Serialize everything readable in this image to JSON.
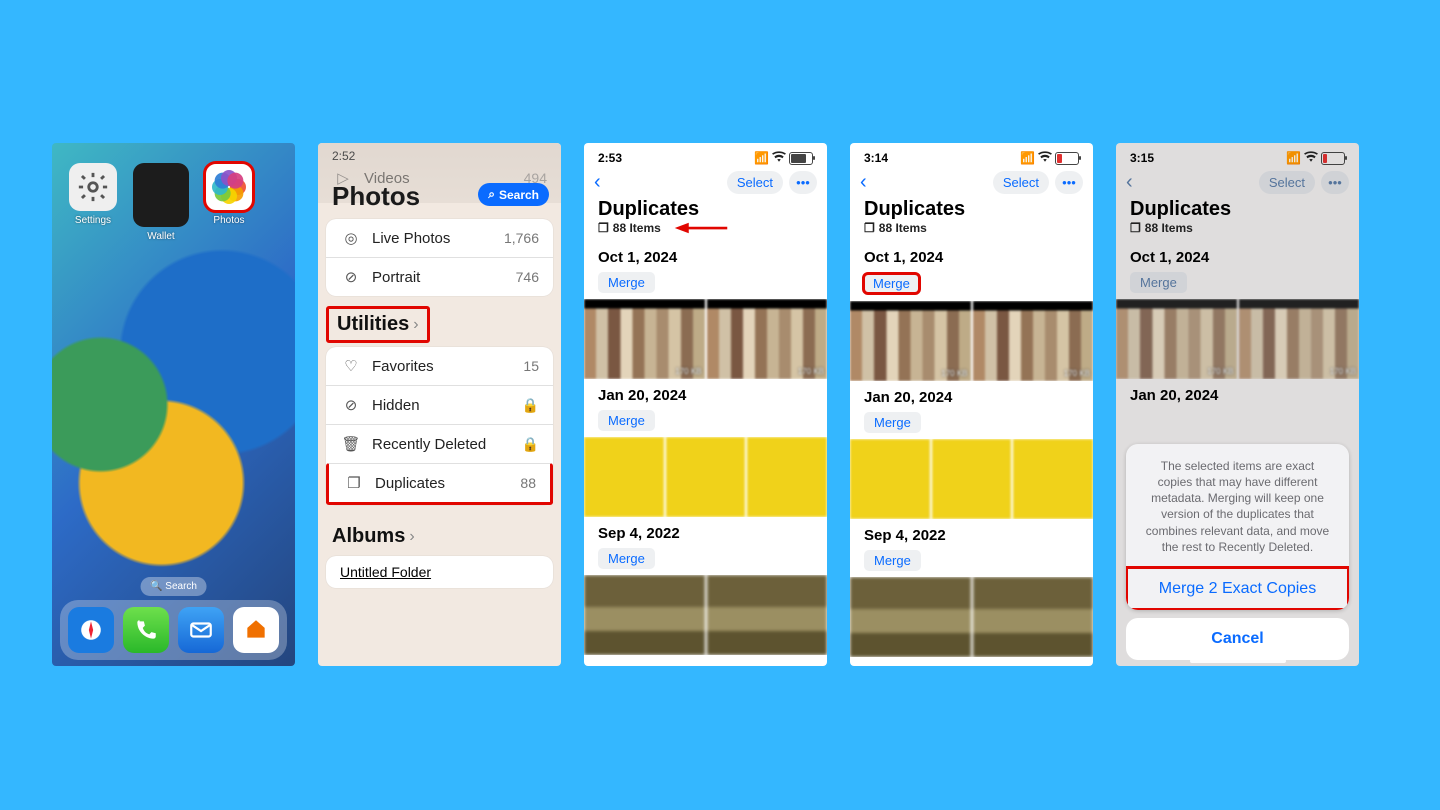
{
  "screen1": {
    "apps": [
      {
        "label": "Settings"
      },
      {
        "label": "Wallet"
      },
      {
        "label": "Photos"
      }
    ],
    "home_search": "Search"
  },
  "screen2": {
    "title": "Photos",
    "search_label": "Search",
    "top_item_label": "Videos",
    "top_item_count": "494",
    "items_a": [
      {
        "icon": "◎",
        "label": "Live Photos",
        "count": "1,766"
      },
      {
        "icon": "⊘",
        "label": "Portrait",
        "count": "746"
      }
    ],
    "utilities_header": "Utilities",
    "items_b": [
      {
        "icon": "♡",
        "label": "Favorites",
        "count": "15"
      },
      {
        "icon": "⊘",
        "label": "Hidden",
        "count": ""
      },
      {
        "icon": "🗑",
        "label": "Recently Deleted",
        "count": ""
      },
      {
        "icon": "❐",
        "label": "Duplicates",
        "count": "88"
      }
    ],
    "albums_header": "Albums",
    "album_item": "Untitled Folder"
  },
  "dup_common": {
    "nav_select": "Select",
    "title": "Duplicates",
    "sub": "88 Items",
    "dates": [
      "Oct 1, 2024",
      "Jan 20, 2024",
      "Sep 4, 2022"
    ],
    "merge": "Merge",
    "kb": "170 KB"
  },
  "screen3": {
    "time": "2:53"
  },
  "screen4": {
    "time": "3:14"
  },
  "screen5": {
    "time": "3:15",
    "sheet_text": "The selected items are exact copies that may have different metadata. Merging will keep one version of the duplicates that combines relevant data, and move the rest to Recently Deleted.",
    "merge_action": "Merge 2 Exact Copies",
    "cancel": "Cancel"
  },
  "time_s2": "2:52"
}
